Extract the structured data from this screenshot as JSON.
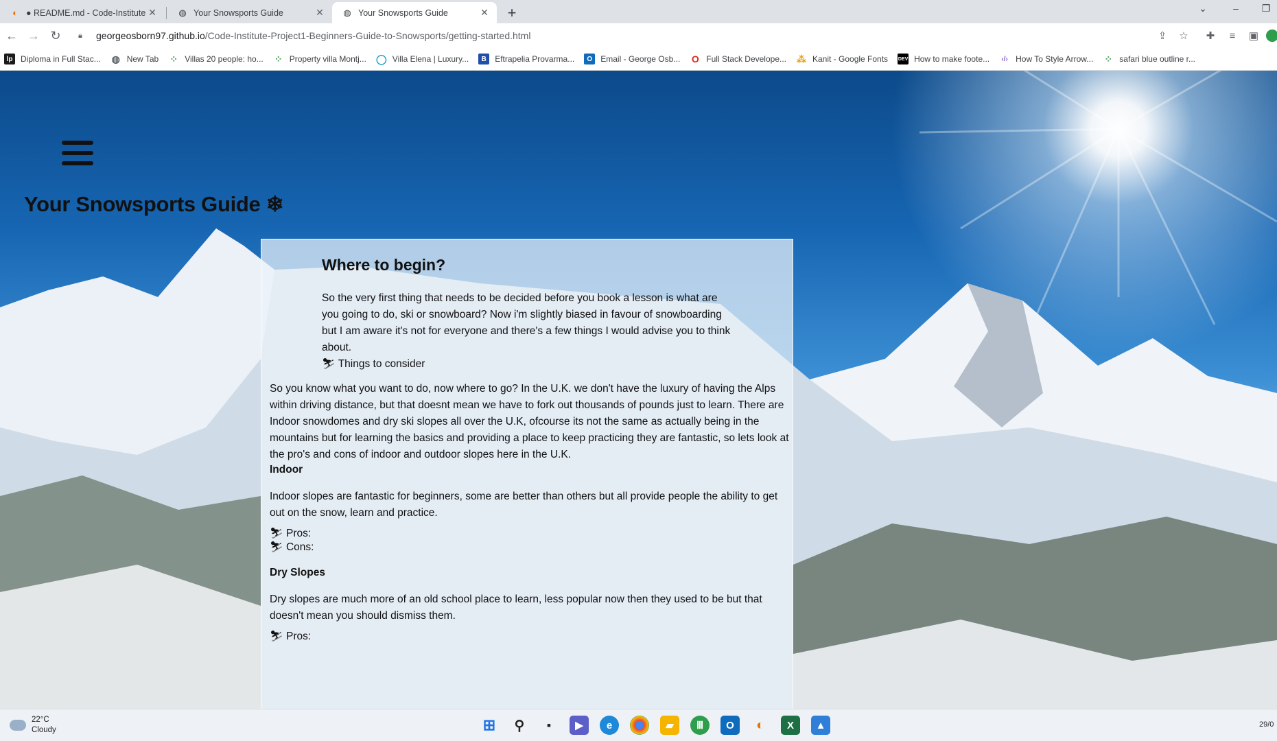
{
  "browser": {
    "tabs": [
      {
        "title": "● README.md - Code-Institute-P",
        "active": false
      },
      {
        "title": "Your Snowsports Guide",
        "active": false
      },
      {
        "title": "Your Snowsports Guide",
        "active": true
      }
    ],
    "address_host": "georgeosborn97.github.io",
    "address_path": "/Code-Institute-Project1-Beginners-Guide-to-Snowsports/getting-started.html",
    "bookmarks": [
      {
        "label": "Diploma in Full Stac...",
        "icon": "lp-icon",
        "color": "#1b1b1b",
        "glyph": "lp"
      },
      {
        "label": "New Tab",
        "icon": "globe-icon",
        "color": "#5f6368",
        "glyph": "◍"
      },
      {
        "label": "Villas 20 people: ho...",
        "icon": "sparkle-icon",
        "color": "#ffffff",
        "glyph": "⁘"
      },
      {
        "label": "Property villa Montj...",
        "icon": "sparkle-icon",
        "color": "#ffffff",
        "glyph": "⁘"
      },
      {
        "label": "Villa Elena | Luxury...",
        "icon": "ring-icon",
        "color": "#1aa0c8",
        "glyph": "◯"
      },
      {
        "label": "Eftrapelia Provarma...",
        "icon": "b-icon",
        "color": "#1f4fa8",
        "glyph": "B"
      },
      {
        "label": "Email - George Osb...",
        "icon": "outlook-icon",
        "color": "#0f6cbd",
        "glyph": "O"
      },
      {
        "label": "Full Stack Develope...",
        "icon": "opera-icon",
        "color": "#e0261b",
        "glyph": "O"
      },
      {
        "label": "Kanit - Google Fonts",
        "icon": "google-fonts-icon",
        "color": "#e8a317",
        "glyph": "⁂"
      },
      {
        "label": "How to make foote...",
        "icon": "dev-icon",
        "color": "#000000",
        "glyph": "DEV"
      },
      {
        "label": "How To Style Arrow...",
        "icon": "code-icon",
        "color": "#ffffff",
        "glyph": "‹/›"
      },
      {
        "label": "safari blue outline r...",
        "icon": "sparkle-icon",
        "color": "#ffffff",
        "glyph": "⁘"
      }
    ]
  },
  "site": {
    "title": "Your Snowsports Guide ❄",
    "heading": "Where to begin?",
    "intro": "So the very first thing that needs to be decided before you book a lesson is what are you going to do, ski or snowboard? Now i'm slightly biased in favour of snowboarding but I am aware it's not for everyone and there's a few things I would advise you to think about.",
    "things_to_consider": "⛷ Things to consider",
    "where_to_go": "So you know what you want to do, now where to go? In the U.K. we don't have the luxury of having the Alps within driving distance, but that doesnt mean we have to fork out thousands of pounds just to learn. There are Indoor snowdomes and dry ski slopes all over the U.K, ofcourse its not the same as actually being in the mountains but for learning the basics and providing a place to keep practicing they are fantastic, so lets look at the pro's and cons of indoor and outdoor slopes here in the U.K.",
    "indoor_heading": "Indoor",
    "indoor_text": "Indoor slopes are fantastic for beginners, some are better than others but all provide people the ability to get out on the snow, learn and practice.",
    "indoor_pros": "⛷ Pros:",
    "indoor_cons": "⛷ Cons:",
    "dry_heading": "Dry Slopes",
    "dry_text": "Dry slopes are much more of an old school place to learn, less popular now then they used to be but that doesn't mean you should dismiss them.",
    "dry_pros": "⛷ Pros:"
  },
  "taskbar": {
    "temperature": "22°C",
    "condition": "Cloudy",
    "clock": "29/0"
  }
}
